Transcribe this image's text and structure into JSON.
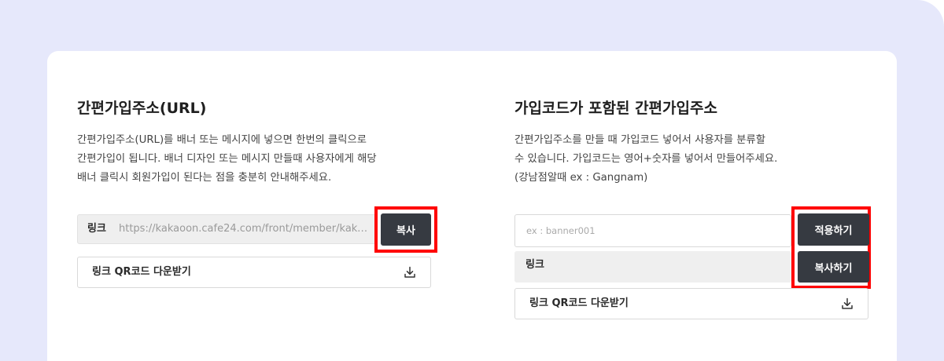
{
  "left": {
    "title": "간편가입주소(URL)",
    "desc": [
      "간편가입주소(URL)를 배너 또는 메시지에 넣으면 한번의 클릭으로",
      "간편가입이 됩니다. 배너 디자인 또는 메시지 만들때 사용자에게 해당",
      "배너 클릭시 회원가입이 된다는 점을 충분히 안내해주세요."
    ],
    "link_label": "링크",
    "link_url": "https://kakaoon.cafe24.com/front/member/kakaoL...",
    "copy_button": "복사",
    "qr_button": "링크 QR코드 다운받기"
  },
  "right": {
    "title": "가입코드가 포함된 간편가입주소",
    "desc": [
      "간편가입주소를 만들 때 가입코드 넣어서 사용자를 분류할",
      "수 있습니다. 가입코드는 영어+숫자를 넣어서 만들어주세요.",
      "(강남점알때 ex : Gangnam)"
    ],
    "code_input": {
      "value": "",
      "placeholder": "ex : banner001"
    },
    "apply_button": "적용하기",
    "link_label": "링크",
    "copy_button": "복사하기",
    "qr_button": "링크 QR코드 다운받기"
  },
  "icons": {
    "download": "download-icon"
  },
  "colors": {
    "background": "#e6e8fb",
    "card": "#ffffff",
    "dark_button": "#363a41",
    "highlight": "#ff0000"
  }
}
